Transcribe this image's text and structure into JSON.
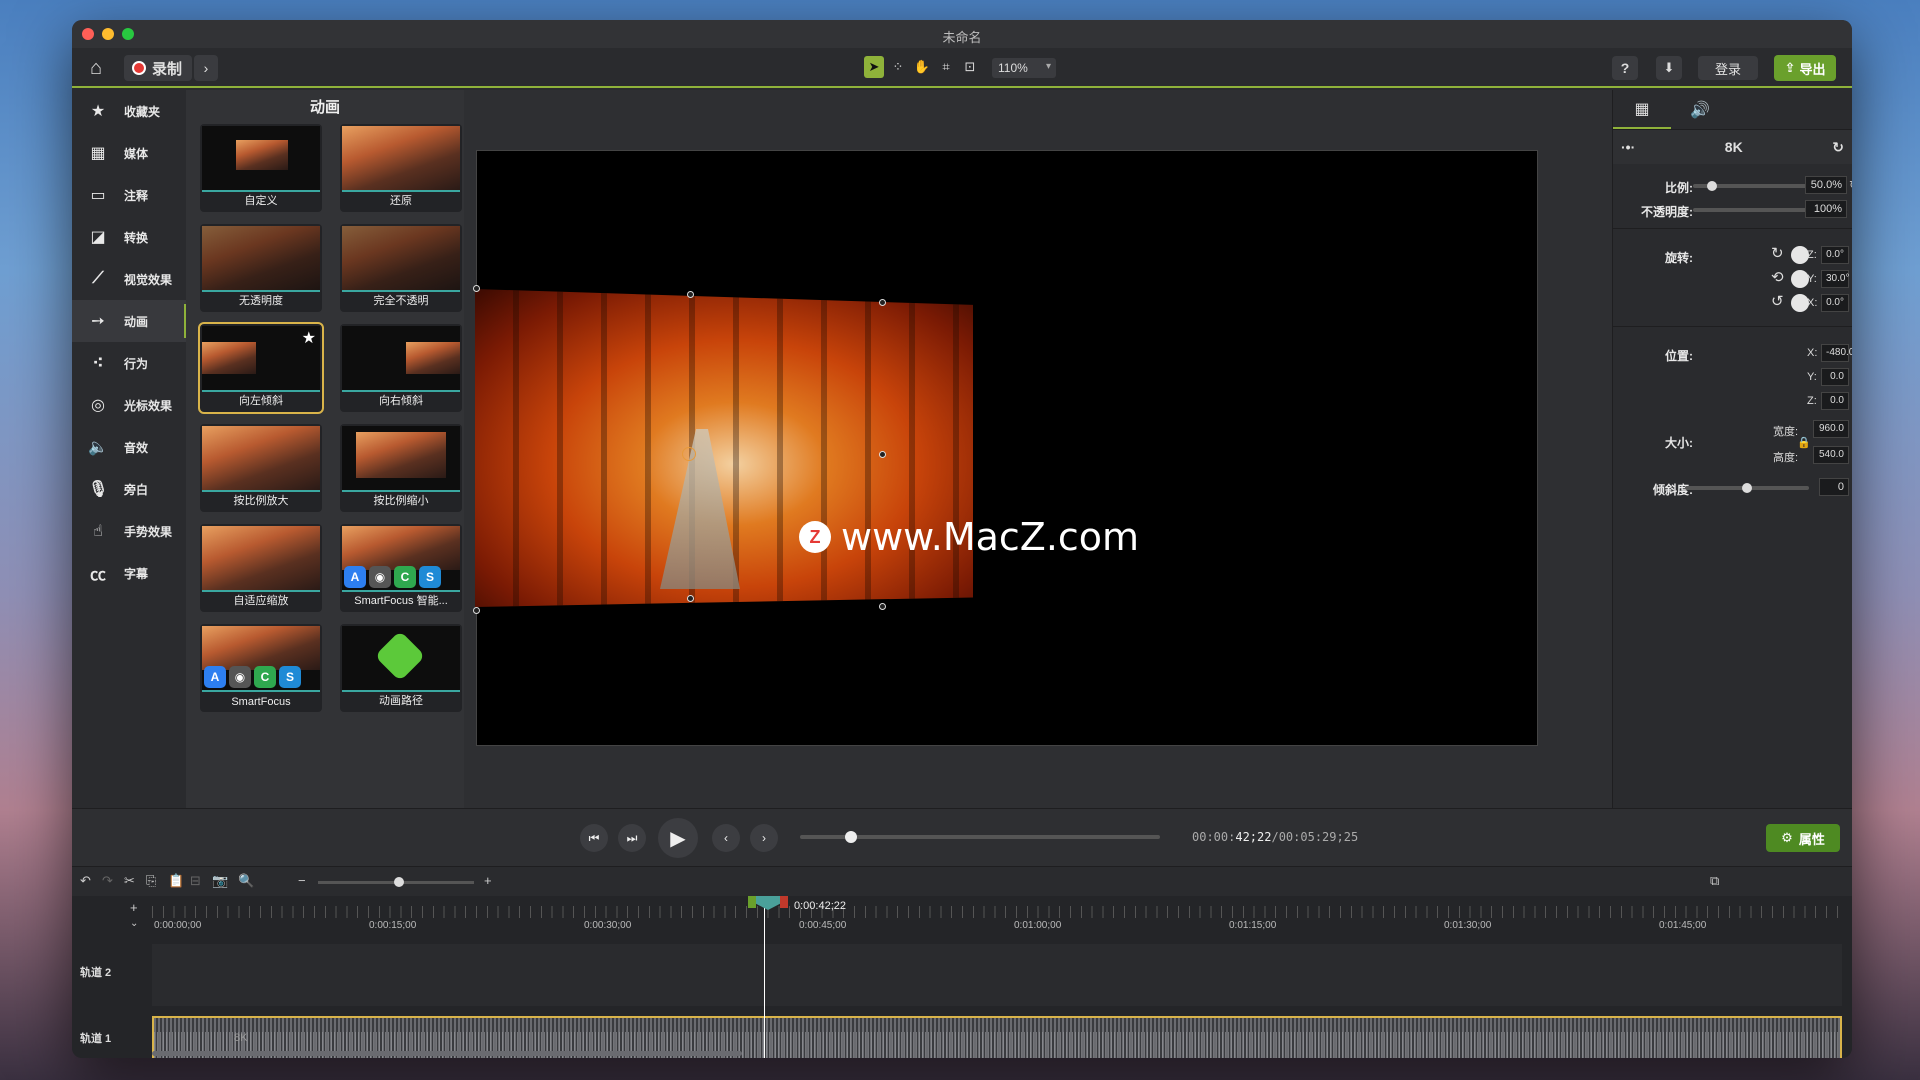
{
  "window": {
    "title": "未命名"
  },
  "toolbar": {
    "record_label": "录制",
    "zoom": "110%",
    "login_label": "登录",
    "export_label": "导出",
    "help_label": "?"
  },
  "sidebar": {
    "items": [
      {
        "label": "收藏夹",
        "icon": "star-icon",
        "glyph": "★"
      },
      {
        "label": "媒体",
        "icon": "film-icon",
        "glyph": "▦"
      },
      {
        "label": "注释",
        "icon": "annotation-icon",
        "glyph": "▭"
      },
      {
        "label": "转换",
        "icon": "transition-icon",
        "glyph": "◪"
      },
      {
        "label": "视觉效果",
        "icon": "wand-icon",
        "glyph": "⟋"
      },
      {
        "label": "动画",
        "icon": "animation-arrow-icon",
        "glyph": "➙"
      },
      {
        "label": "行为",
        "icon": "behavior-icon",
        "glyph": "⁖"
      },
      {
        "label": "光标效果",
        "icon": "cursor-effect-icon",
        "glyph": "◎"
      },
      {
        "label": "音效",
        "icon": "speaker-icon",
        "glyph": "🔈"
      },
      {
        "label": "旁白",
        "icon": "microphone-icon",
        "glyph": "🎙"
      },
      {
        "label": "手势效果",
        "icon": "gesture-hand-icon",
        "glyph": "☝"
      },
      {
        "label": "字幕",
        "icon": "cc-icon",
        "glyph": "㏄"
      }
    ]
  },
  "animations": {
    "title": "动画",
    "items": [
      {
        "label": "自定义"
      },
      {
        "label": "还原"
      },
      {
        "label": "无透明度"
      },
      {
        "label": "完全不透明"
      },
      {
        "label": "向左倾斜"
      },
      {
        "label": "向右倾斜"
      },
      {
        "label": "按比例放大"
      },
      {
        "label": "按比例缩小"
      },
      {
        "label": "自适应缩放"
      },
      {
        "label": "SmartFocus 智能..."
      },
      {
        "label": "SmartFocus"
      },
      {
        "label": "动画路径"
      }
    ]
  },
  "watermark": {
    "logo": "Z",
    "text": "www.MacZ.com"
  },
  "properties": {
    "media_name": "8K",
    "scale_label": "比例:",
    "scale_value": "50.0%",
    "scale_fraction": 0.12,
    "opacity_label": "不透明度:",
    "opacity_value": "100%",
    "opacity_fraction": 1.0,
    "rotation_label": "旋转:",
    "rot_z_label": "Z:",
    "rot_z": "0.0°",
    "rot_y_label": "Y:",
    "rot_y": "30.0°",
    "rot_x_label": "X:",
    "rot_x": "0.0°",
    "position_label": "位置:",
    "pos_x_label": "X:",
    "pos_x": "-480.0",
    "pos_y_label": "Y:",
    "pos_y": "0.0",
    "pos_z_label": "Z:",
    "pos_z": "0.0",
    "size_label": "大小:",
    "width_label": "宽度:",
    "width": "960.0",
    "height_label": "高度:",
    "height": "540.0",
    "skew_label": "倾斜度:",
    "skew": "0",
    "skew_fraction": 0.5
  },
  "transport": {
    "timecode_prefix": "00:00:",
    "timecode_current": "42;22",
    "timecode_total": "/00:05:29;25",
    "scrub_fraction": 0.13,
    "properties_label": "属性"
  },
  "timeline": {
    "playhead_time": "0:00:42;22",
    "ruler": [
      "0:00:00;00",
      "0:00:15;00",
      "0:00:30;00",
      "0:00:45;00",
      "0:01:00;00",
      "0:01:15;00",
      "0:01:30;00",
      "0:01:45;00"
    ],
    "tracks": [
      {
        "label": "轨道 2"
      },
      {
        "label": "轨道 1"
      }
    ],
    "clip_label": "8K"
  }
}
